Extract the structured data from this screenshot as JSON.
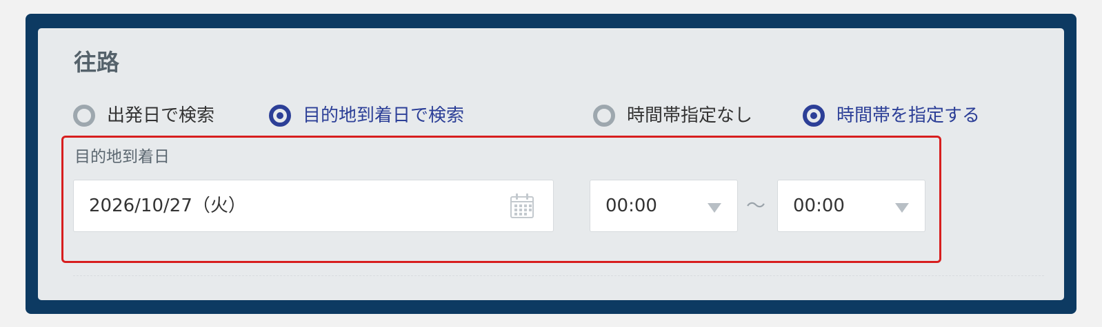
{
  "section": {
    "title": "往路"
  },
  "search_mode": {
    "options": [
      {
        "label": "出発日で検索",
        "selected": false
      },
      {
        "label": "目的地到着日で検索",
        "selected": true
      }
    ]
  },
  "time_mode": {
    "options": [
      {
        "label": "時間帯指定なし",
        "selected": false
      },
      {
        "label": "時間帯を指定する",
        "selected": true
      }
    ]
  },
  "arrival_date": {
    "label": "目的地到着日",
    "value": "2026/10/27（火）",
    "icon": "calendar-icon"
  },
  "time_range": {
    "from": "00:00",
    "separator": "〜",
    "to": "00:00"
  },
  "colors": {
    "frame": "#0d3a62",
    "panel": "#e7eaec",
    "accent": "#2c3f97",
    "highlight": "#d71e1e",
    "radio_inactive": "#9da7ae"
  }
}
